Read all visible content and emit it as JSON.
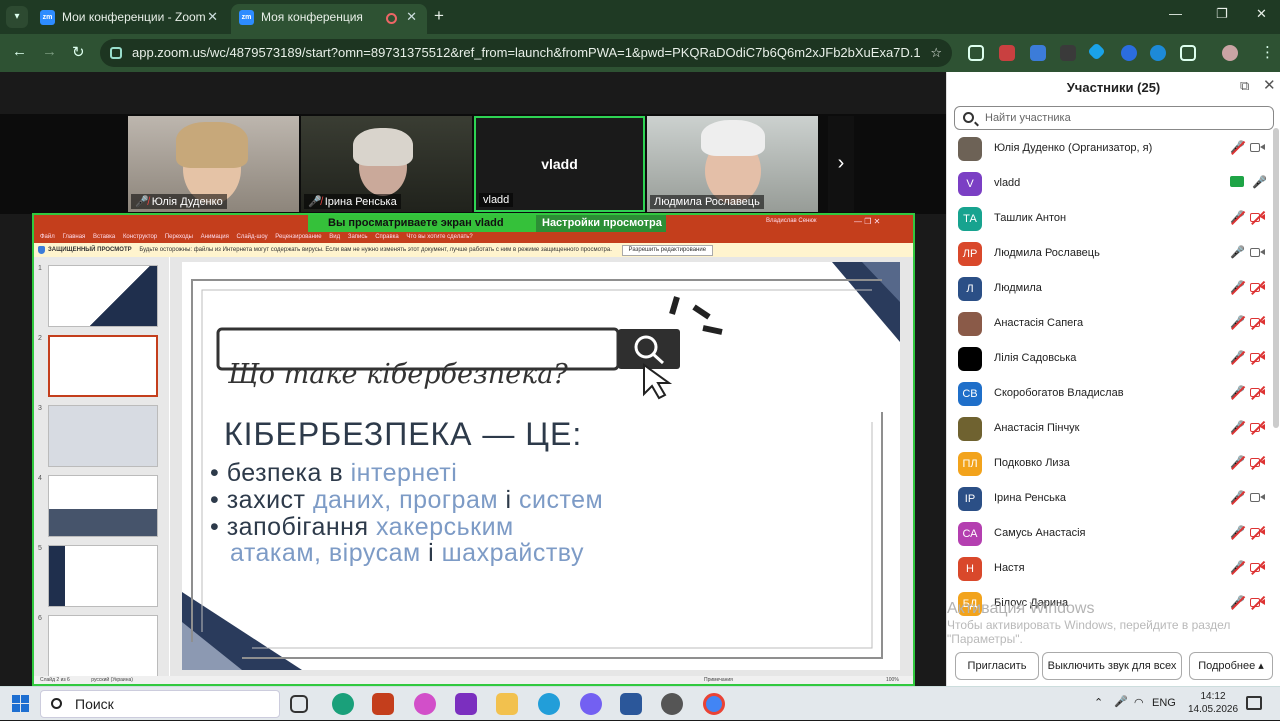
{
  "browser": {
    "tabs": [
      {
        "title": "Мои конференции - Zoom",
        "favicon": "zm"
      },
      {
        "title": "Моя конференция",
        "favicon": "zm"
      }
    ],
    "url": "app.zoom.us/wc/4879573189/start?omn=89731375512&ref_from=launch&fromPWA=1&pwd=PKQRaDOdiC7b6Q6m2xJFb2bXuExa7D.1"
  },
  "meeting": {
    "videos": [
      {
        "name": "Юлія Дуденко",
        "muted": true
      },
      {
        "name": "Ірина Ренська",
        "muted": true
      },
      {
        "name": "vladd",
        "center_label": "vladd",
        "muted": false
      },
      {
        "name": "Людмила Рославець",
        "muted": false
      }
    ],
    "share_banner": {
      "viewing": "Вы просматриваете экран  vladd",
      "settings": "Настройки просмотра"
    }
  },
  "presentation": {
    "menu": [
      "Файл",
      "Главная",
      "Вставка",
      "Конструктор",
      "Переходы",
      "Анимация",
      "Слайд-шоу",
      "Рецензирование",
      "Вид",
      "Запись",
      "Справка",
      "Что вы хотите сделать?"
    ],
    "user": "Владислав Сенюк",
    "protected_label": "ЗАЩИЩЕННЫЙ ПРОСМОТР",
    "protected_text": "Будьте осторожны: файлы из Интернета могут содержать вирусы. Если вам не нужно изменять этот документ, лучше работать с ним в режиме защищенного просмотра.",
    "enable_editing": "Разрешить редактирование",
    "status_left": "Слайд 2 из 6",
    "status_lang": "русский (Украина)",
    "status_notes": "Примечания",
    "status_zoom": "100%",
    "slide_numbers": [
      "1",
      "2",
      "3",
      "4",
      "5",
      "6"
    ],
    "slide": {
      "search_text": "Що таке кібербезпека?",
      "heading": "КІБЕРБЕЗПЕКА — ЦЕ:",
      "bullets": [
        {
          "a": "безпека в ",
          "b": "інтернеті",
          "c": ""
        },
        {
          "a": "захист ",
          "b": "даних, програм ",
          "c": "і ",
          "d": "систем"
        },
        {
          "a": "запобігання ",
          "b": "хакерським",
          "c": ""
        },
        {
          "a": "",
          "b": "атакам, вірусам ",
          "c": "і ",
          "d": "шахрайству"
        }
      ]
    }
  },
  "participants": {
    "title": "Участники (25)",
    "search_placeholder": "Найти участника",
    "list": [
      {
        "name": "Юлія Дуденко (Организатор, я)",
        "initials": "",
        "color": "#6d6256",
        "mic": "muted",
        "cam": "on"
      },
      {
        "name": "vladd",
        "initials": "V",
        "color": "#7b3fc4",
        "mic": "on",
        "cam": "share"
      },
      {
        "name": "Ташлик Антон",
        "initials": "ТА",
        "color": "#17a38f",
        "mic": "muted",
        "cam": "off"
      },
      {
        "name": "Людмила Рославець",
        "initials": "ЛР",
        "color": "#d9482b",
        "mic": "on",
        "cam": "on"
      },
      {
        "name": "Людмила",
        "initials": "Л",
        "color": "#2b4f86",
        "mic": "muted",
        "cam": "off"
      },
      {
        "name": "Анастасія Сапега",
        "initials": "",
        "color": "#8a5a48",
        "mic": "muted",
        "cam": "off"
      },
      {
        "name": "Лілія Садовська",
        "initials": "",
        "color": "#000000",
        "mic": "muted",
        "cam": "off"
      },
      {
        "name": "Скоробогатов Владислав",
        "initials": "СВ",
        "color": "#1f6fc9",
        "mic": "muted",
        "cam": "off"
      },
      {
        "name": "Анастасія Пінчук",
        "initials": "",
        "color": "#6f6230",
        "mic": "muted",
        "cam": "off"
      },
      {
        "name": "Подковко Лиза",
        "initials": "ПЛ",
        "color": "#f2a31c",
        "mic": "muted",
        "cam": "off"
      },
      {
        "name": "Ірина Ренська",
        "initials": "ІР",
        "color": "#2b4f86",
        "mic": "muted",
        "cam": "on"
      },
      {
        "name": "Самусь Анастасія",
        "initials": "СА",
        "color": "#b43fb0",
        "mic": "muted",
        "cam": "off"
      },
      {
        "name": "Настя",
        "initials": "Н",
        "color": "#d9482b",
        "mic": "muted",
        "cam": "off"
      },
      {
        "name": "Білоус Дарина",
        "initials": "БД",
        "color": "#f2a31c",
        "mic": "muted",
        "cam": "off"
      }
    ],
    "invite": "Пригласить",
    "mute_all": "Выключить звук для всех",
    "more": "Подробнее"
  },
  "watermark": {
    "line1": "Активация Windows",
    "line2": "Чтобы активировать Windows, перейдите в раздел",
    "line3": "\"Параметры\"."
  },
  "taskbar": {
    "search": "Поиск",
    "lang": "ENG",
    "time": "14:12",
    "date": "14.05.2026"
  }
}
